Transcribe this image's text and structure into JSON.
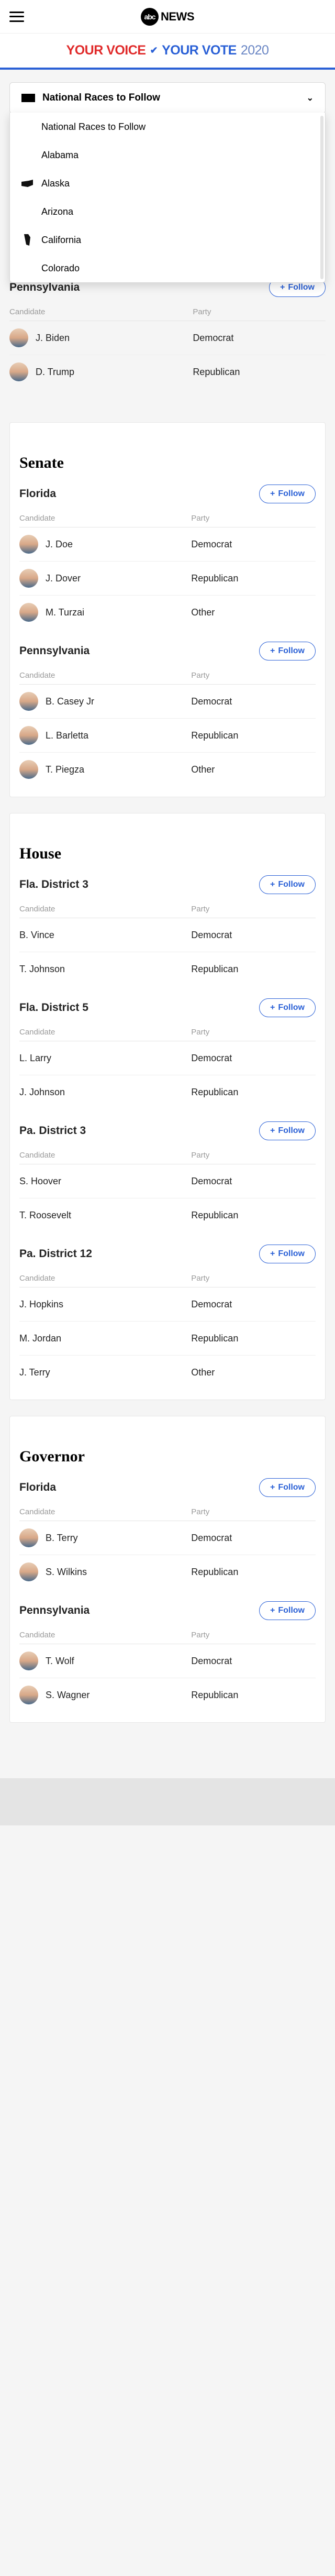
{
  "nav": {
    "logo_abc": "abc",
    "logo_news": "NEWS"
  },
  "banner": {
    "voice": "YOUR VOICE",
    "vote": "YOUR VOTE",
    "year": "2020"
  },
  "dropdown": {
    "selected": "National Races to Follow",
    "options": [
      "National Races to Follow",
      "Alabama",
      "Alaska",
      "Arizona",
      "California",
      "Colorado"
    ]
  },
  "follow_label": "Follow",
  "hdr_candidate": "Candidate",
  "hdr_party": "Party",
  "president_rows_1": [
    {
      "name": "D. Trump",
      "party": "Republican",
      "avatar": true
    }
  ],
  "pres_pa_name": "Pennsylvania",
  "pres_pa_rows": [
    {
      "name": "J. Biden",
      "party": "Democrat",
      "avatar": true
    },
    {
      "name": "D. Trump",
      "party": "Republican",
      "avatar": true
    }
  ],
  "senate_title": "Senate",
  "sen": [
    {
      "race": "Florida",
      "rows": [
        {
          "name": "J. Doe",
          "party": "Democrat",
          "avatar": true
        },
        {
          "name": "J. Dover",
          "party": "Republican",
          "avatar": true
        },
        {
          "name": "M. Turzai",
          "party": "Other",
          "avatar": true
        }
      ]
    },
    {
      "race": "Pennsylvania",
      "rows": [
        {
          "name": "B. Casey Jr",
          "party": "Democrat",
          "avatar": true
        },
        {
          "name": "L. Barletta",
          "party": "Republican",
          "avatar": true
        },
        {
          "name": "T. Piegza",
          "party": "Other",
          "avatar": true
        }
      ]
    }
  ],
  "house_title": "House",
  "house": [
    {
      "race": "Fla. District 3",
      "rows": [
        {
          "name": "B. Vince",
          "party": "Democrat",
          "avatar": false
        },
        {
          "name": "T. Johnson",
          "party": "Republican",
          "avatar": false
        }
      ]
    },
    {
      "race": "Fla. District 5",
      "rows": [
        {
          "name": "L. Larry",
          "party": "Democrat",
          "avatar": false
        },
        {
          "name": "J. Johnson",
          "party": "Republican",
          "avatar": false
        }
      ]
    },
    {
      "race": "Pa. District 3",
      "rows": [
        {
          "name": "S. Hoover",
          "party": "Democrat",
          "avatar": false
        },
        {
          "name": "T. Roosevelt",
          "party": "Republican",
          "avatar": false
        }
      ]
    },
    {
      "race": "Pa. District 12",
      "rows": [
        {
          "name": "J. Hopkins",
          "party": "Democrat",
          "avatar": false
        },
        {
          "name": "M. Jordan",
          "party": "Republican",
          "avatar": false
        },
        {
          "name": "J. Terry",
          "party": "Other",
          "avatar": false
        }
      ]
    }
  ],
  "gov_title": "Governor",
  "gov": [
    {
      "race": "Florida",
      "rows": [
        {
          "name": "B. Terry",
          "party": "Democrat",
          "avatar": true
        },
        {
          "name": "S. Wilkins",
          "party": "Republican",
          "avatar": true
        }
      ]
    },
    {
      "race": "Pennsylvania",
      "rows": [
        {
          "name": "T. Wolf",
          "party": "Democrat",
          "avatar": true
        },
        {
          "name": "S. Wagner",
          "party": "Republican",
          "avatar": true
        }
      ]
    }
  ]
}
